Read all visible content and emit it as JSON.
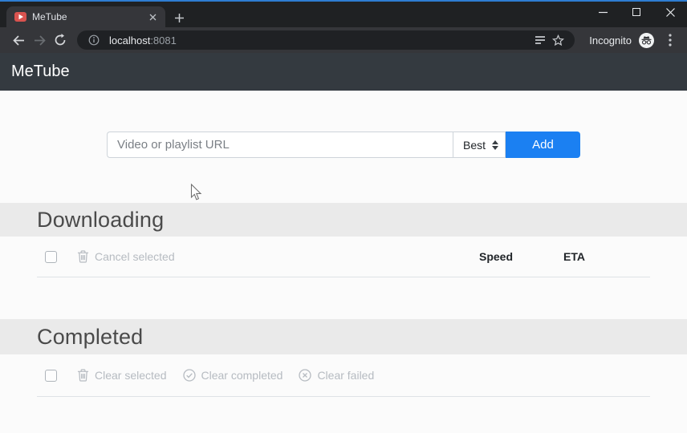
{
  "browser": {
    "tab_title": "MeTube",
    "address_host": "localhost",
    "address_port": ":8081",
    "incognito_label": "Incognito"
  },
  "app": {
    "navbar_title": "MeTube",
    "form": {
      "url_placeholder": "Video or playlist URL",
      "quality_selected": "Best",
      "add_label": "Add"
    },
    "downloading": {
      "title": "Downloading",
      "cancel_selected_label": "Cancel selected",
      "speed_header": "Speed",
      "eta_header": "ETA"
    },
    "completed": {
      "title": "Completed",
      "clear_selected_label": "Clear selected",
      "clear_completed_label": "Clear completed",
      "clear_failed_label": "Clear failed"
    }
  },
  "colors": {
    "primary_button": "#1b80f2",
    "navbar_bg": "#343a40",
    "section_band_bg": "#eaeaea",
    "favicon_red": "#d9534f",
    "window_accent_top": "#2e7dd2"
  }
}
